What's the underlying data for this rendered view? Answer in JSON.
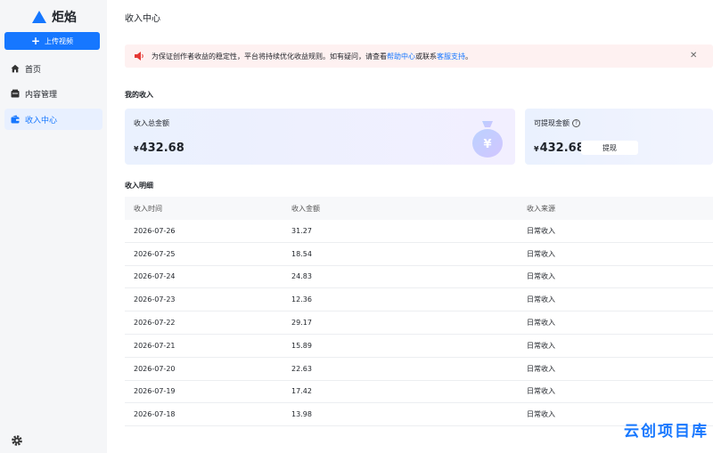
{
  "sidebar": {
    "logo_text": "炬焰",
    "upload_label": "上传视频",
    "items": [
      {
        "label": "首页",
        "icon": "home-icon"
      },
      {
        "label": "内容管理",
        "icon": "folder-icon"
      },
      {
        "label": "收入中心",
        "icon": "wallet-icon"
      }
    ]
  },
  "main": {
    "title": "收入中心",
    "notice": {
      "text_before": "为保证创作者收益的稳定性，平台将持续优化收益规则。如有疑问，请查看",
      "link1": "帮助中心",
      "text_mid": "或联系",
      "link2": "客服支持",
      "text_after": "。"
    },
    "my_income_title": "我的收入",
    "total_card": {
      "label": "收入总金额",
      "currency": "¥",
      "amount": "432.68"
    },
    "withdraw_card": {
      "label": "可提现金额",
      "currency": "¥",
      "amount": "432.68",
      "button": "提现"
    },
    "detail_title": "收入明细",
    "table": {
      "headers": [
        "收入时间",
        "收入金额",
        "收入来源"
      ],
      "rows": [
        [
          "2026-07-26",
          "31.27",
          "日常收入"
        ],
        [
          "2026-07-25",
          "18.54",
          "日常收入"
        ],
        [
          "2026-07-24",
          "24.83",
          "日常收入"
        ],
        [
          "2026-07-23",
          "12.36",
          "日常收入"
        ],
        [
          "2026-07-22",
          "29.17",
          "日常收入"
        ],
        [
          "2026-07-21",
          "15.89",
          "日常收入"
        ],
        [
          "2026-07-20",
          "22.63",
          "日常收入"
        ],
        [
          "2026-07-19",
          "17.42",
          "日常收入"
        ],
        [
          "2026-07-18",
          "13.98",
          "日常收入"
        ]
      ]
    }
  },
  "watermark": "云创项目库",
  "colors": {
    "accent": "#1677ff",
    "notice_bg": "#fef1f1",
    "speaker": "#e53935"
  }
}
